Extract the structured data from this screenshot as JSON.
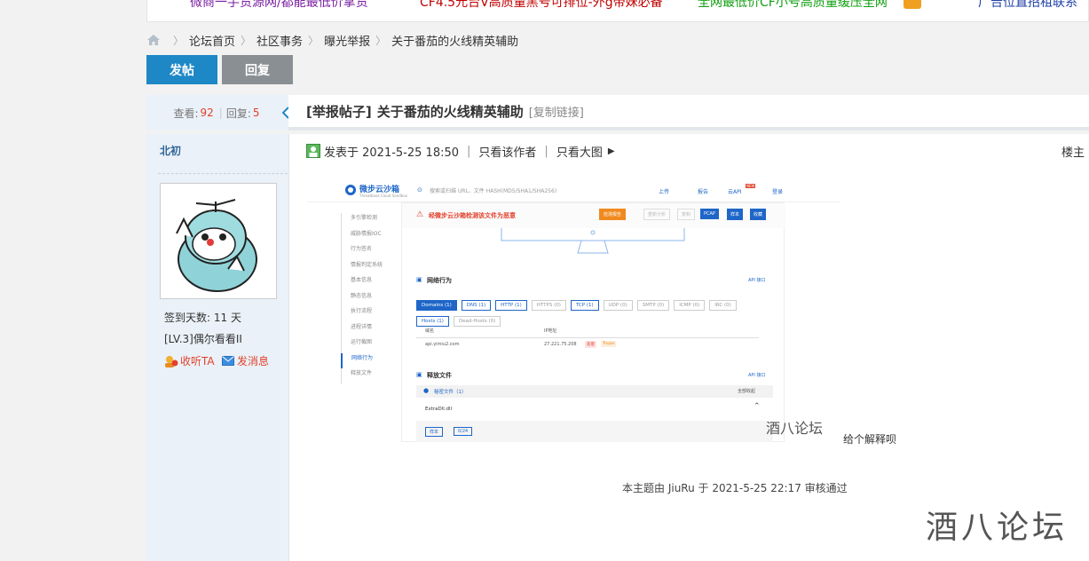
{
  "top_links": [
    {
      "text": "微商一手货源网/都能最低价拿货",
      "color": "#7a1fa2"
    },
    {
      "text": "CF4.5元台V高质量黑号可排位-外g带妹必备",
      "color": "#c00000"
    },
    {
      "text": "全网最低价CF小号高质量缓压全网",
      "color": "#11a011"
    },
    {
      "text": "广告位直招租联系",
      "color": "#1e3fa5"
    }
  ],
  "breadcrumb": [
    "论坛首页",
    "社区事务",
    "曝光举报",
    "关于番茄的火线精英辅助"
  ],
  "buttons": {
    "post": "发帖",
    "reply": "回复"
  },
  "stats": {
    "views_label": "查看:",
    "views": "92",
    "replies_label": "回复:",
    "replies": "5"
  },
  "thread": {
    "tag": "[举报帖子]",
    "title": "关于番茄的火线精英辅助",
    "copy_link": "[复制链接]"
  },
  "user": {
    "name": "北初",
    "checkin": "签到天数: 11 天",
    "level": "[LV.3]偶尔看看II",
    "follow": "收听TA",
    "message": "发消息"
  },
  "post_meta": {
    "posted": "发表于 2021-5-25 18:50",
    "only_author": "只看该作者",
    "big_image": "只看大图",
    "floor": "楼主"
  },
  "screenshot": {
    "brand": "微步云沙箱",
    "brand_sub": "Threatbook Cloud Sandbox",
    "search_placeholder": "搜索或扫描 URL，文件 HASH(MD5/SHA1/SHA256)",
    "nav": [
      "上传",
      "报告",
      "云API",
      "登录"
    ],
    "nav_badge": "NEW",
    "alert": "经微步云沙箱检测该文件为恶意",
    "actions": [
      "检测报告",
      "重新分析",
      "复制",
      "PCAP",
      "样本",
      "收藏"
    ],
    "side_items": [
      "多引擎检测",
      "威胁情报IOC",
      "行为签名",
      "情报判定系统",
      "基本信息",
      "静态信息",
      "执行流程",
      "进程详情",
      "运行截图",
      "网络行为",
      "释放文件"
    ],
    "net_title": "网络行为",
    "api_link": "API 接口",
    "pills_row1": [
      "Domains (1)",
      "DNS (1)",
      "HTTP (1)",
      "HTTPS (0)",
      "TCP (1)",
      "UDP (0)",
      "SMTP (0)",
      "ICMP (0)",
      "IRC (0)"
    ],
    "pills_row2": [
      "Hosts (1)",
      "Dead-Hosts (0)"
    ],
    "col_domain": "域名",
    "col_ip": "IP地址",
    "domain": "api.yimiu2.com",
    "ip": "27.221.75.208",
    "tag_threat": "恶意",
    "tag_trojan": "Trojan",
    "release_title": "释放文件",
    "release_api": "API 接口",
    "malicious_files": "秘密文件（1）",
    "collapse_all": "全部收起",
    "file_name": "ExtraDll.dll",
    "btn_sample": "样本",
    "btn_detect": "0/24"
  },
  "explain_text": "给个解释呗",
  "watermark_small": "酒八论坛",
  "review_text": "本主题由 JiuRu 于 2021-5-25 22:17 审核通过",
  "watermark_big": "酒八论坛",
  "colors": {
    "primary": "#1e88c7",
    "grey_button": "#8a8f94",
    "accent_red": "#e2412b",
    "panel_bg": "#eaf1f8"
  }
}
